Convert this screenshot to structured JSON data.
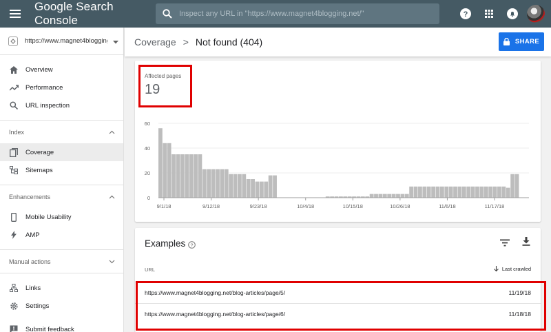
{
  "app": {
    "title": "Google Search Console"
  },
  "search": {
    "placeholder": "Inspect any URL in \"https://www.magnet4blogging.net/\""
  },
  "sidebar": {
    "property": "https://www.magnet4blogging...",
    "nav_top": [
      {
        "label": "Overview",
        "icon": "home-icon"
      },
      {
        "label": "Performance",
        "icon": "trending-icon"
      },
      {
        "label": "URL inspection",
        "icon": "search-icon"
      }
    ],
    "index_section": "Index",
    "index_items": [
      {
        "label": "Coverage",
        "icon": "coverage-icon"
      },
      {
        "label": "Sitemaps",
        "icon": "sitemaps-icon"
      }
    ],
    "enhancements_section": "Enhancements",
    "enhancements_items": [
      {
        "label": "Mobile Usability",
        "icon": "phone-icon"
      },
      {
        "label": "AMP",
        "icon": "bolt-icon"
      }
    ],
    "manual_section": "Manual actions",
    "bottom_items": [
      {
        "label": "Links",
        "icon": "links-icon"
      },
      {
        "label": "Settings",
        "icon": "gear-icon"
      },
      {
        "label": "Submit feedback",
        "icon": "feedback-icon"
      }
    ]
  },
  "header": {
    "crumb1": "Coverage",
    "crumb_sep": ">",
    "crumb2": "Not found (404)",
    "share": "SHARE"
  },
  "summary": {
    "label": "Affected pages",
    "value": "19"
  },
  "chart_data": {
    "type": "bar",
    "y_ticks": [
      "60",
      "40",
      "20",
      "0"
    ],
    "ylim": [
      0,
      60
    ],
    "x_labels": [
      "9/1/18",
      "9/12/18",
      "9/23/18",
      "10/4/18",
      "10/15/18",
      "10/26/18",
      "11/6/18",
      "11/17/18"
    ],
    "values": [
      56,
      44,
      44,
      35,
      35,
      35,
      35,
      35,
      35,
      35,
      23,
      23,
      23,
      23,
      23,
      23,
      19,
      19,
      19,
      19,
      15,
      15,
      13,
      13,
      13,
      18,
      18,
      0,
      0,
      0,
      0,
      0,
      0,
      0,
      0,
      0,
      0,
      0,
      1,
      1,
      1,
      1,
      1,
      1,
      1,
      1,
      1,
      1,
      3,
      3,
      3,
      3,
      3,
      3,
      3,
      3,
      3,
      9,
      9,
      9,
      9,
      9,
      9,
      9,
      9,
      9,
      9,
      9,
      9,
      9,
      9,
      9,
      9,
      9,
      9,
      9,
      9,
      9,
      9,
      8,
      19,
      19
    ],
    "bar_color": "#bdbdbd"
  },
  "examples": {
    "title": "Examples",
    "col_url": "URL",
    "col_last": "Last crawled",
    "rows": [
      {
        "url": "https://www.magnet4blogging.net/blog-articles/page/5/",
        "date": "11/19/18"
      },
      {
        "url": "https://www.magnet4blogging.net/blog-articles/page/6/",
        "date": "11/18/18"
      }
    ]
  },
  "colors": {
    "topbar": "#455a64",
    "accent": "#1a73e8",
    "highlight": "#e00000"
  }
}
